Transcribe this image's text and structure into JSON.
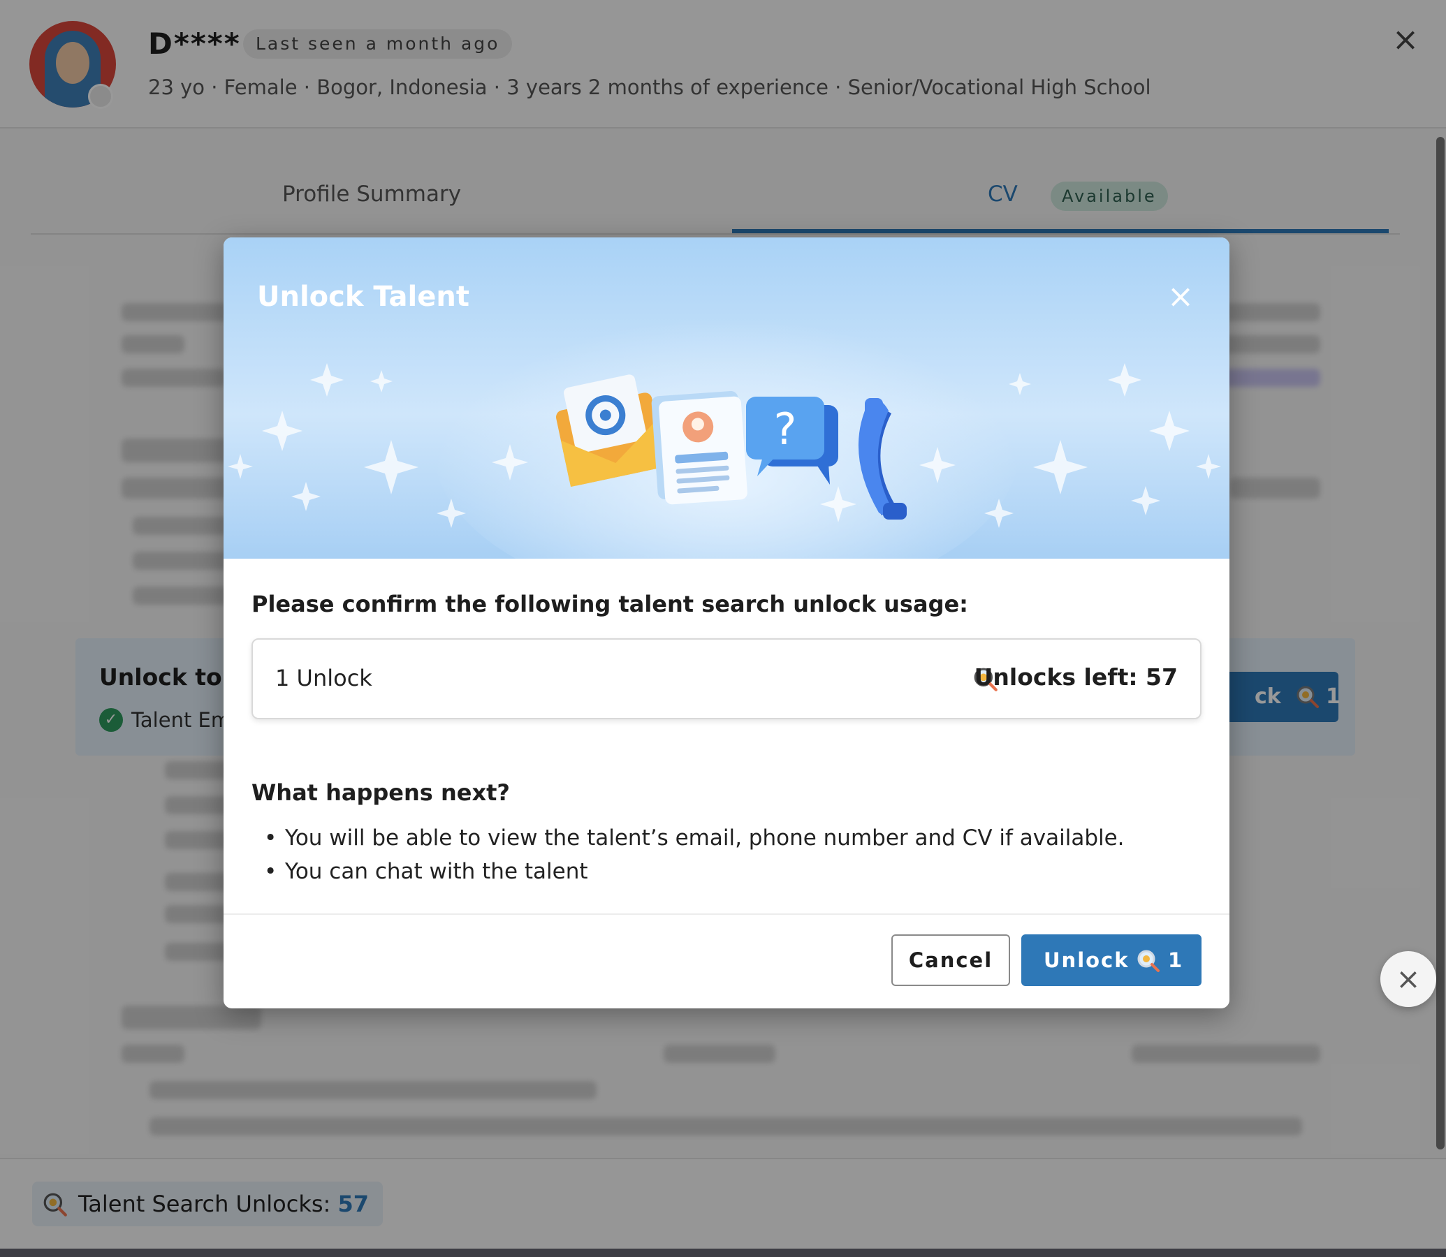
{
  "profile": {
    "name": "D****",
    "last_seen": "Last seen a month ago",
    "meta": "23 yo · Female · Bogor, Indonesia · 3 years 2 months of experience · Senior/Vocational High School"
  },
  "tabs": {
    "profile_summary": "Profile Summary",
    "cv": "CV",
    "cv_badge": "Available"
  },
  "unlock_panel": {
    "title": "Unlock to v",
    "item": "Talent Em",
    "button_label": "ck",
    "button_cost": "1"
  },
  "footer": {
    "credits_label": "Talent Search Unlocks:",
    "credits_value": "57"
  },
  "modal": {
    "title": "Unlock Talent",
    "prompt": "Please confirm the following talent search unlock usage:",
    "usage_amount": "1 Unlock",
    "usage_left": "Unlocks left: 57",
    "next_title": "What happens next?",
    "next_items": [
      "You will be able to view the talent’s email, phone number and CV if available.",
      "You can chat with the talent"
    ],
    "cancel_label": "Cancel",
    "unlock_label": "Unlock",
    "unlock_cost": "1"
  },
  "icons": {
    "close": "close-icon",
    "search_credit": "magnifier-credit-icon",
    "check": "check-circle-icon"
  },
  "colors": {
    "primary": "#2e78b7",
    "success": "#2e9a5e",
    "hero_blue": "#a9d2f6"
  }
}
